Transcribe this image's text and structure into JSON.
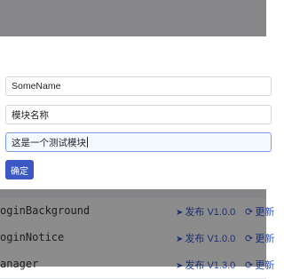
{
  "modal": {
    "fields": [
      {
        "value": "SomeName"
      },
      {
        "value": "模块名称"
      },
      {
        "value": "这是一个测试模块"
      }
    ],
    "confirm_label": "确定"
  },
  "background_list": {
    "rows": [
      {
        "name": "oginBackground",
        "publish_icon": "send-icon",
        "publish_label": "发布 V1.0.0",
        "update_icon": "refresh-icon",
        "update_label": "更新"
      },
      {
        "name": "oginNotice",
        "publish_icon": "send-icon",
        "publish_label": "发布 V1.0.0",
        "update_icon": "refresh-icon",
        "update_label": "更新"
      },
      {
        "name": "anager",
        "publish_icon": "send-icon",
        "publish_label": "发布 V1.3.0",
        "update_icon": "refresh-icon",
        "update_label": "更新"
      }
    ]
  },
  "colors": {
    "accent": "#3c58c4",
    "link": "#2f54c9"
  }
}
